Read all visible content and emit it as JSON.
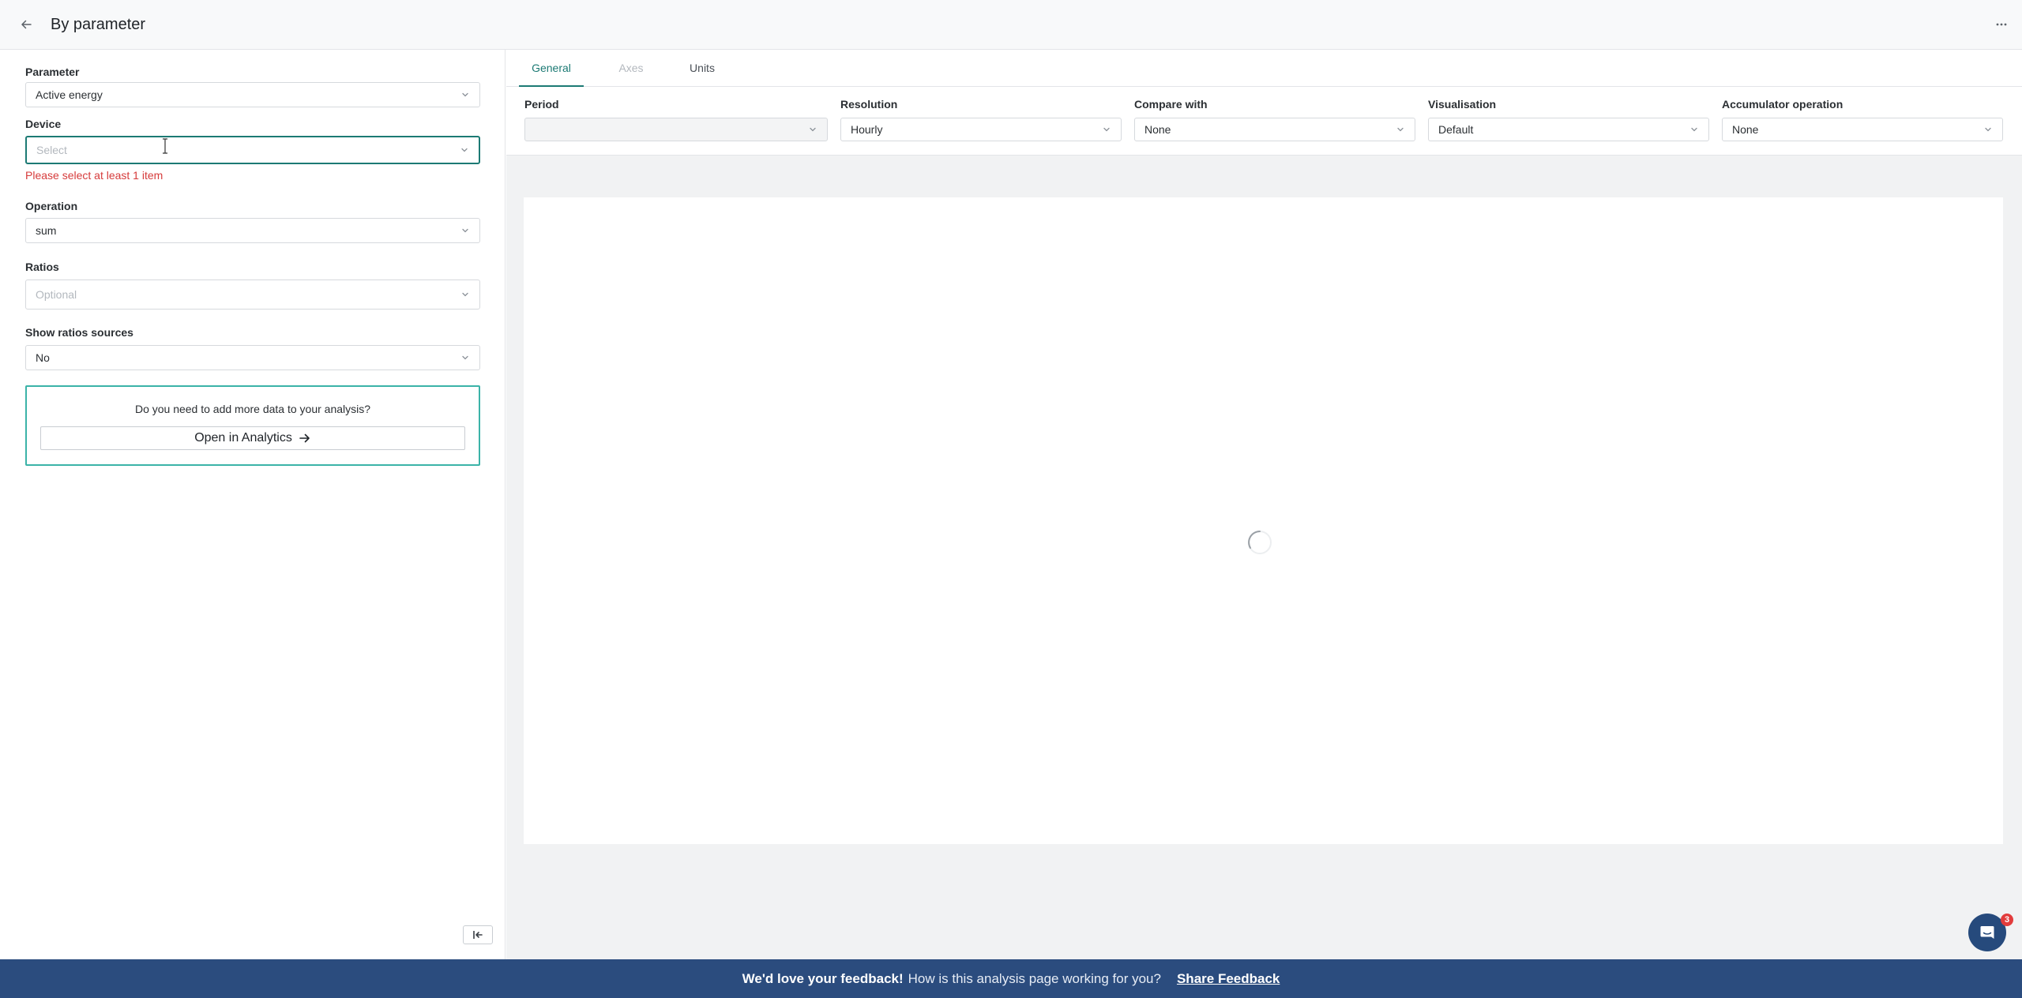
{
  "header": {
    "title": "By parameter",
    "back_icon": "arrow-left-icon",
    "more_icon": "ellipsis-icon"
  },
  "left_panel": {
    "parameter": {
      "label": "Parameter",
      "value": "Active energy"
    },
    "device": {
      "label": "Device",
      "placeholder": "Select",
      "error": "Please select at least 1 item"
    },
    "operation": {
      "label": "Operation",
      "value": "sum"
    },
    "ratios": {
      "label": "Ratios",
      "placeholder": "Optional"
    },
    "show_ratios_sources": {
      "label": "Show ratios sources",
      "value": "No"
    },
    "analytics": {
      "question": "Do you need to add more data to your analysis?",
      "button_label": "Open in Analytics"
    }
  },
  "tabs": [
    {
      "label": "General",
      "state": "active"
    },
    {
      "label": "Axes",
      "state": "disabled"
    },
    {
      "label": "Units",
      "state": "normal"
    }
  ],
  "filters": {
    "period": {
      "label": "Period",
      "value": ""
    },
    "resolution": {
      "label": "Resolution",
      "value": "Hourly"
    },
    "compare_with": {
      "label": "Compare with",
      "value": "None"
    },
    "visualisation": {
      "label": "Visualisation",
      "value": "Default"
    },
    "accumulator_operation": {
      "label": "Accumulator operation",
      "value": "None"
    }
  },
  "feedback": {
    "strong": "We'd love your feedback!",
    "question": "How is this analysis page working for you?",
    "link": "Share Feedback"
  },
  "chat": {
    "badge_count": "3"
  },
  "colors": {
    "accent": "#1c7a74",
    "box_border": "#3bb3a8",
    "error": "#d63b3b",
    "banner": "#2b4c7e"
  }
}
